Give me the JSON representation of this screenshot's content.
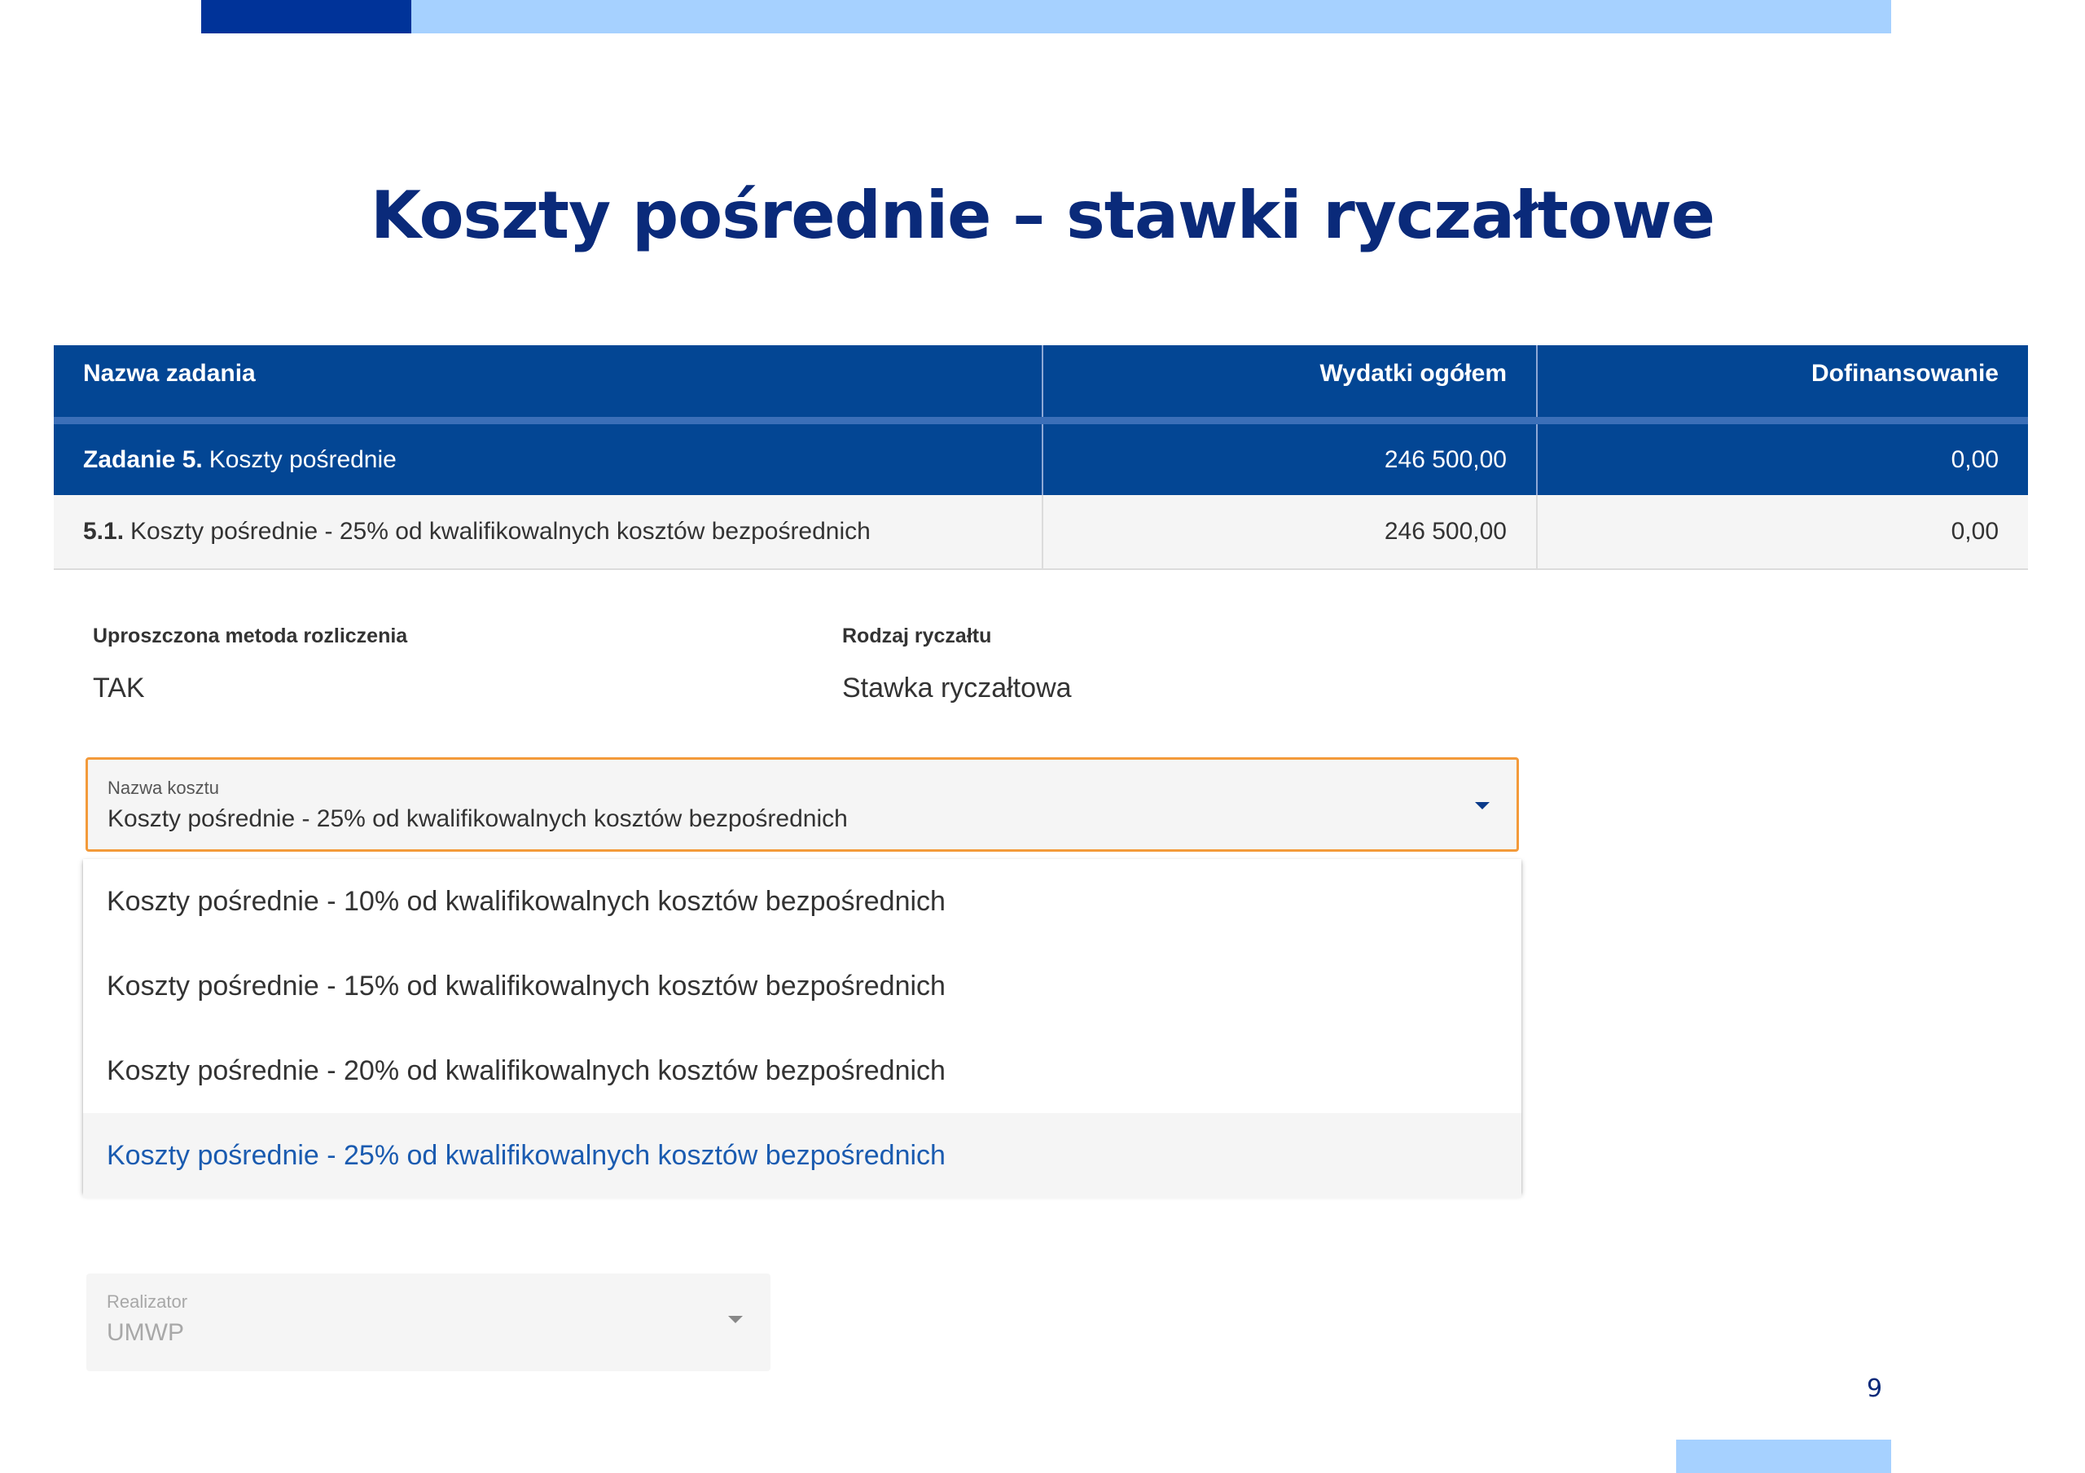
{
  "title": "Koszty pośrednie – stawki ryczałtowe",
  "table": {
    "headers": [
      "Nazwa zadania",
      "Wydatki ogółem",
      "Dofinansowanie"
    ],
    "task": {
      "prefix": "Zadanie 5.",
      "name": "Koszty pośrednie",
      "wydatki": "246 500,00",
      "dofinansowanie": "0,00"
    },
    "subtask": {
      "prefix": "5.1.",
      "name": "Koszty pośrednie - 25% od kwalifikowalnych kosztów bezpośrednich",
      "wydatki": "246 500,00",
      "dofinansowanie": "0,00"
    }
  },
  "fields": {
    "uproszczona": {
      "label": "Uproszczona metoda rozliczenia",
      "value": "TAK"
    },
    "rodzaj": {
      "label": "Rodzaj ryczałtu",
      "value": "Stawka ryczałtowa"
    }
  },
  "nazwa_kosztu": {
    "label": "Nazwa kosztu",
    "value": "Koszty pośrednie - 25% od kwalifikowalnych kosztów bezpośrednich",
    "options": [
      "Koszty pośrednie - 10% od kwalifikowalnych kosztów bezpośrednich",
      "Koszty pośrednie - 15% od kwalifikowalnych kosztów bezpośrednich",
      "Koszty pośrednie - 20% od kwalifikowalnych kosztów bezpośrednich",
      "Koszty pośrednie - 25% od kwalifikowalnych kosztów bezpośrednich"
    ],
    "selected_index": 3
  },
  "realizator": {
    "label": "Realizator",
    "value": "UMWP"
  },
  "page_number": "9",
  "colors": {
    "brand_dark": "#003399",
    "brand_light": "#a6d1ff",
    "table_header": "#034694",
    "focus_border": "#f39a3a",
    "selected_option_text": "#1a5bb0"
  }
}
